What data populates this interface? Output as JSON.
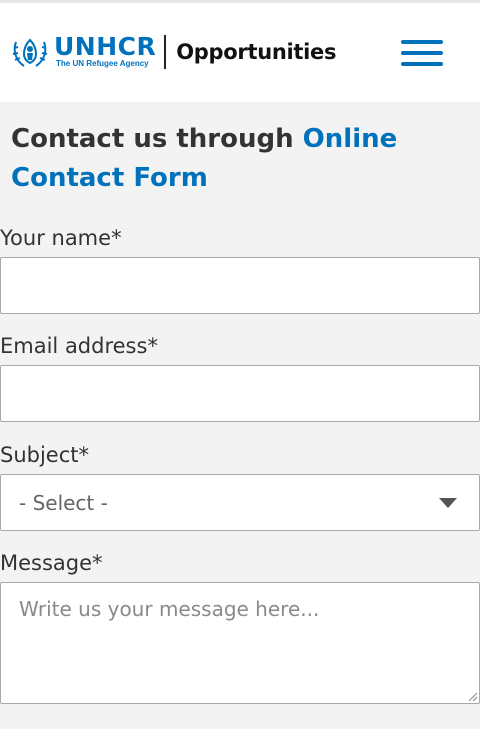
{
  "header": {
    "brand": "UNHCR",
    "tagline": "The UN Refugee Agency",
    "section": "Opportunities",
    "menu_icon": "hamburger-menu-icon"
  },
  "form": {
    "heading_prefix": "Contact us through ",
    "heading_accent": "Online Contact Form",
    "name_label": "Your name",
    "email_label": "Email address",
    "subject_label": "Subject",
    "subject_value": "- Select -",
    "message_label": "Message",
    "message_placeholder": "Write us your message here...",
    "required_mark": "*"
  },
  "colors": {
    "accent": "#0072bc",
    "background": "#f3f3f3",
    "text": "#333333"
  }
}
